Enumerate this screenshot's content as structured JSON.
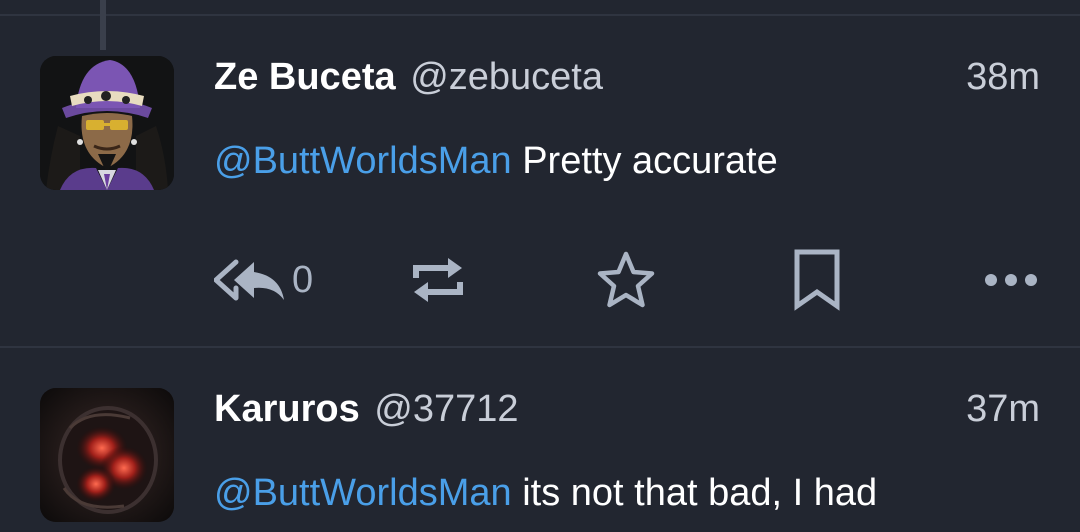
{
  "colors": {
    "background": "#222630",
    "mention": "#4a9fe8",
    "secondary_text": "#c9ced8",
    "icon": "#aab4c4"
  },
  "tweets": [
    {
      "display_name": "Ze Buceta",
      "handle": "@zebuceta",
      "time": "38m",
      "mention": "@ButtWorldsMan",
      "text": " Pretty accurate",
      "reply_count": "0",
      "avatar": "cartoon-character-avatar",
      "icons": [
        "reply-all-icon",
        "retweet-icon",
        "star-icon",
        "bookmark-icon",
        "more-icon"
      ]
    },
    {
      "display_name": "Karuros",
      "handle": "@37712",
      "time": "37m",
      "mention": "@ButtWorldsMan",
      "text": " its not that bad, I had",
      "avatar": "dark-red-abstract-avatar"
    }
  ]
}
